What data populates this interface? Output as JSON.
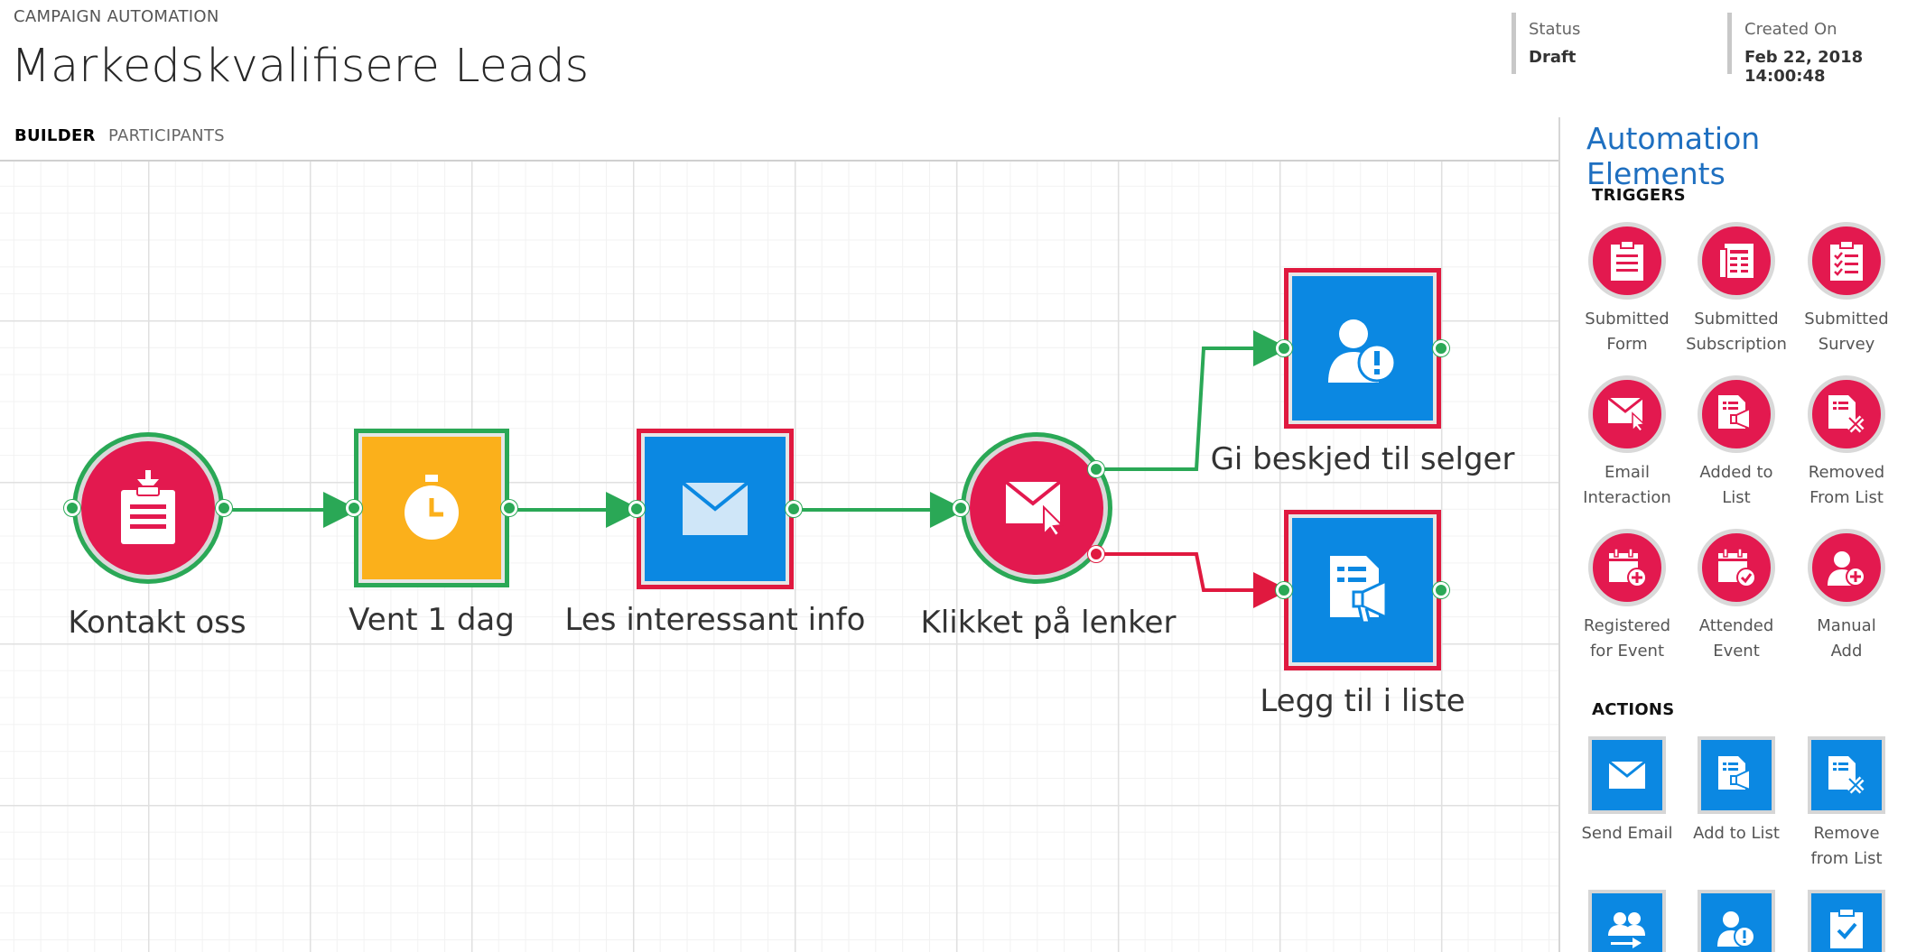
{
  "header": {
    "breadcrumb": "CAMPAIGN AUTOMATION",
    "title": "Markedskvalifisere Leads",
    "status_label": "Status",
    "status_value": "Draft",
    "created_label": "Created On",
    "created_value": "Feb 22, 2018 14:00:48"
  },
  "tabs": [
    {
      "label": "BUILDER",
      "active": true
    },
    {
      "label": "PARTICIPANTS",
      "active": false
    }
  ],
  "canvas": {
    "nodes": [
      {
        "id": "n1",
        "label": "Kontakt oss",
        "kind": "trigger",
        "icon": "submitted-form-icon"
      },
      {
        "id": "n2",
        "label": "Vent 1 dag",
        "kind": "wait",
        "icon": "stopwatch-icon"
      },
      {
        "id": "n3",
        "label": "Les interessant info",
        "kind": "action",
        "icon": "email-icon"
      },
      {
        "id": "n4",
        "label": "Klikket på lenker",
        "kind": "trigger",
        "icon": "email-interaction-icon"
      },
      {
        "id": "n5",
        "label": "Gi beskjed til selger",
        "kind": "action",
        "icon": "notify-user-icon"
      },
      {
        "id": "n6",
        "label": "Legg til i liste",
        "kind": "action",
        "icon": "add-to-list-icon"
      }
    ],
    "edges": [
      {
        "from": "n1",
        "to": "n2",
        "branch": "yes"
      },
      {
        "from": "n2",
        "to": "n3",
        "branch": "yes"
      },
      {
        "from": "n3",
        "to": "n4",
        "branch": "yes"
      },
      {
        "from": "n4",
        "to": "n5",
        "branch": "yes"
      },
      {
        "from": "n4",
        "to": "n6",
        "branch": "no"
      }
    ]
  },
  "sidebar": {
    "title": "Automation Elements",
    "triggers_title": "TRIGGERS",
    "triggers": [
      {
        "label": "Submitted\nForm",
        "icon": "submitted-form-icon"
      },
      {
        "label": "Submitted\nSubscription",
        "icon": "submitted-subscription-icon"
      },
      {
        "label": "Submitted\nSurvey",
        "icon": "submitted-survey-icon"
      },
      {
        "label": "Email\nInteraction",
        "icon": "email-interaction-icon"
      },
      {
        "label": "Added to\nList",
        "icon": "added-to-list-icon"
      },
      {
        "label": "Removed\nFrom List",
        "icon": "removed-from-list-icon"
      },
      {
        "label": "Registered\nfor Event",
        "icon": "registered-event-icon"
      },
      {
        "label": "Attended\nEvent",
        "icon": "attended-event-icon"
      },
      {
        "label": "Manual\nAdd",
        "icon": "manual-add-icon"
      }
    ],
    "actions_title": "ACTIONS",
    "actions": [
      {
        "label": "Send Email",
        "icon": "send-email-icon"
      },
      {
        "label": "Add to List",
        "icon": "add-to-list-icon"
      },
      {
        "label": "Remove\nfrom List",
        "icon": "remove-from-list-icon"
      },
      {
        "label": "",
        "icon": "move-contact-icon"
      },
      {
        "label": "",
        "icon": "notify-user-icon"
      },
      {
        "label": "",
        "icon": "task-icon"
      }
    ]
  },
  "colors": {
    "trigger": "#e3194f",
    "action": "#0b88e2",
    "wait": "#fbb01b",
    "connector_yes": "#2aa856",
    "connector_no": "#e0193f",
    "accent_title": "#1e6fc0"
  }
}
